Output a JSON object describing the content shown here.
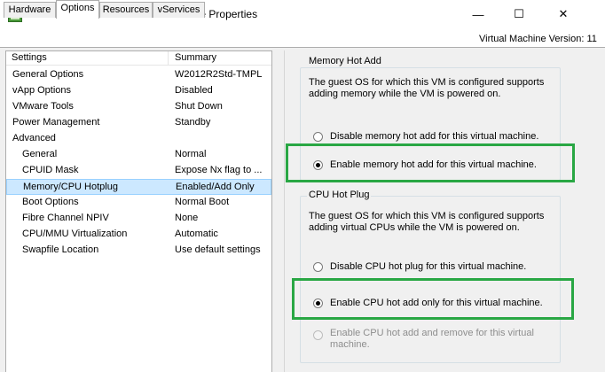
{
  "window": {
    "title": "W2012R2Std-TMPL - Virtual Machine Properties",
    "minimize_glyph": "—",
    "maximize_glyph": "☐",
    "close_glyph": "✕"
  },
  "tabs": [
    {
      "label": "Hardware",
      "active": false
    },
    {
      "label": "Options",
      "active": true
    },
    {
      "label": "Resources",
      "active": false
    },
    {
      "label": "vServices",
      "active": false
    }
  ],
  "vm_version": "Virtual Machine Version: 11",
  "options_list": {
    "headers": {
      "settings": "Settings",
      "summary": "Summary"
    },
    "rows": [
      {
        "name": "General Options",
        "summary": "W2012R2Std-TMPL",
        "indent": false,
        "selected": false
      },
      {
        "name": "vApp Options",
        "summary": "Disabled",
        "indent": false,
        "selected": false
      },
      {
        "name": "VMware Tools",
        "summary": "Shut Down",
        "indent": false,
        "selected": false
      },
      {
        "name": "Power Management",
        "summary": "Standby",
        "indent": false,
        "selected": false
      },
      {
        "name": "Advanced",
        "summary": "",
        "indent": false,
        "selected": false
      },
      {
        "name": "General",
        "summary": "Normal",
        "indent": true,
        "selected": false
      },
      {
        "name": "CPUID Mask",
        "summary": "Expose Nx flag to ...",
        "indent": true,
        "selected": false
      },
      {
        "name": "Memory/CPU Hotplug",
        "summary": "Enabled/Add Only",
        "indent": true,
        "selected": true
      },
      {
        "name": "Boot Options",
        "summary": "Normal Boot",
        "indent": true,
        "selected": false
      },
      {
        "name": "Fibre Channel NPIV",
        "summary": "None",
        "indent": true,
        "selected": false
      },
      {
        "name": "CPU/MMU Virtualization",
        "summary": "Automatic",
        "indent": true,
        "selected": false
      },
      {
        "name": "Swapfile Location",
        "summary": "Use default settings",
        "indent": true,
        "selected": false
      }
    ]
  },
  "memory_hot_add": {
    "legend": "Memory Hot Add",
    "description": "The guest OS for which this VM is configured supports adding memory while the VM is powered on.",
    "options": [
      {
        "label": "Disable memory hot add for this virtual machine.",
        "checked": false,
        "disabled": false
      },
      {
        "label": "Enable memory hot add for this virtual machine.",
        "checked": true,
        "disabled": false
      }
    ]
  },
  "cpu_hot_plug": {
    "legend": "CPU Hot Plug",
    "description": "The guest OS for which this VM is configured supports adding virtual CPUs while the VM is powered on.",
    "options": [
      {
        "label": "Disable CPU hot plug for this virtual machine.",
        "checked": false,
        "disabled": false
      },
      {
        "label": "Enable CPU hot add only for this virtual machine.",
        "checked": true,
        "disabled": false
      },
      {
        "label": "Enable CPU hot add and remove for this virtual machine.",
        "checked": false,
        "disabled": true
      }
    ]
  },
  "colors": {
    "highlight": "#29a744",
    "selection": "#cce8ff",
    "dialog_bg": "#f0f0f0"
  }
}
